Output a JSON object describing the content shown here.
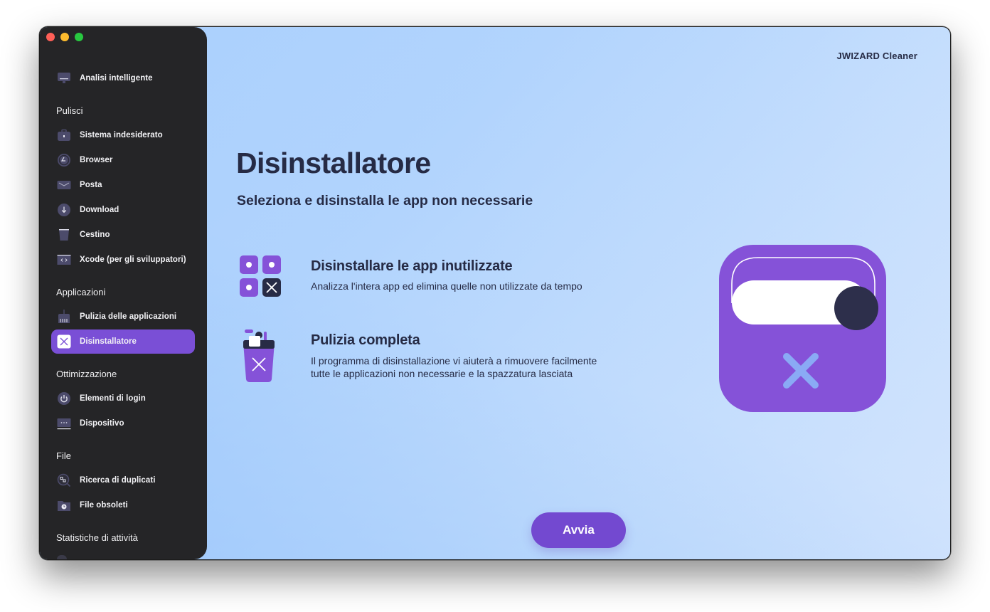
{
  "window": {
    "controls": [
      "close",
      "minimize",
      "zoom"
    ]
  },
  "sidebar": {
    "top_item": {
      "label": "Analisi intelligente",
      "icon": "monitor-icon"
    },
    "sections": [
      {
        "title": "Pulisci",
        "items": [
          {
            "label": "Sistema indesiderato",
            "icon": "briefcase-icon"
          },
          {
            "label": "Browser",
            "icon": "compass-icon"
          },
          {
            "label": "Posta",
            "icon": "mail-icon"
          },
          {
            "label": "Download",
            "icon": "download-icon"
          },
          {
            "label": "Cestino",
            "icon": "trash-icon"
          },
          {
            "label": "Xcode (per gli sviluppatori)",
            "icon": "code-icon"
          }
        ]
      },
      {
        "title": "Applicazioni",
        "items": [
          {
            "label": "Pulizia delle applicazioni",
            "icon": "broom-icon"
          },
          {
            "label": "Disinstallatore",
            "icon": "uninstall-icon",
            "active": true
          }
        ]
      },
      {
        "title": "Ottimizzazione",
        "items": [
          {
            "label": "Elementi di login",
            "icon": "power-icon"
          },
          {
            "label": "Dispositivo",
            "icon": "device-icon"
          }
        ]
      },
      {
        "title": "File",
        "items": [
          {
            "label": "Ricerca di duplicati",
            "icon": "duplicate-search-icon"
          },
          {
            "label": "File obsoleti",
            "icon": "old-files-icon"
          }
        ]
      },
      {
        "title": "Statistiche di attività",
        "items": []
      }
    ]
  },
  "header": {
    "brand": "JWIZARD Cleaner"
  },
  "main": {
    "title": "Disinstallatore",
    "subtitle": "Seleziona e disinstalla le app non necessarie",
    "features": [
      {
        "icon": "app-grid-remove-icon",
        "title": "Disinstallare le app inutilizzate",
        "description": "Analizza l'intera app ed elimina quelle non utilizzate da tempo"
      },
      {
        "icon": "trash-bin-x-icon",
        "title": "Pulizia completa",
        "description": "Il programma di disinstallazione vi aiuterà a rimuovere facilmente\ntutte le applicazioni non necessarie e la spazzatura lasciata"
      }
    ],
    "illustration": "uninstaller-toggle-icon",
    "start_button": "Avvia"
  },
  "colors": {
    "accent": "#7a4fd6",
    "button": "#7349d0",
    "sidebar_bg": "#252527",
    "text_dark": "#262b45",
    "icon_tile": "#8552d8",
    "x_light": "#8aaaf5"
  }
}
